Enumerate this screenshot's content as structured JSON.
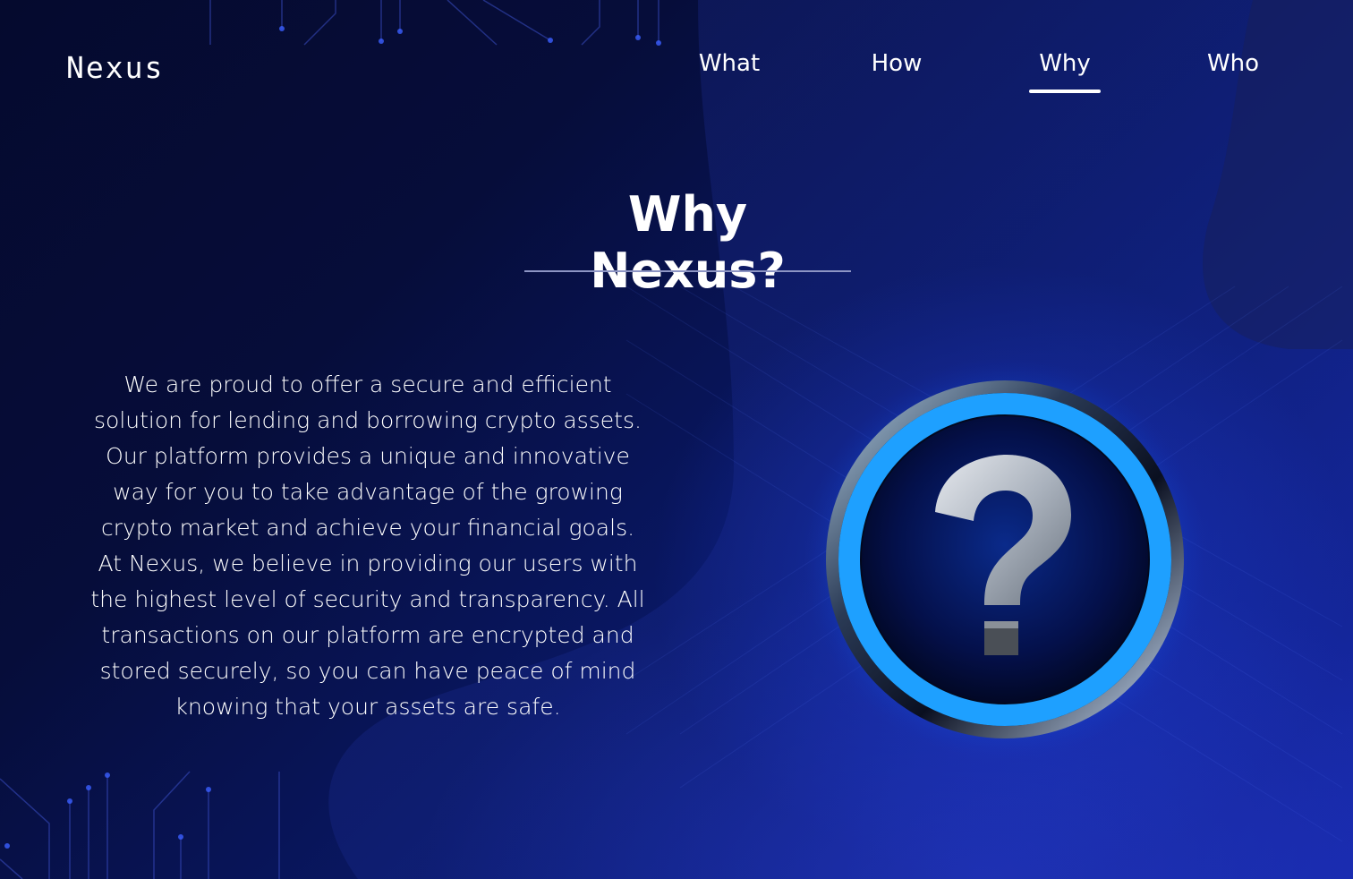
{
  "brand": {
    "name": "Nexus"
  },
  "nav": {
    "items": [
      {
        "label": "What"
      },
      {
        "label": "How"
      },
      {
        "label": "Why"
      },
      {
        "label": "Who"
      }
    ],
    "active_item": "Why"
  },
  "section": {
    "title": "Why Nexus?",
    "paragraphs": [
      "We are proud to offer a secure and efficient solution for lending and borrowing crypto assets. Our platform provides a unique and innovative way for you to take advantage of the growing crypto market and achieve your financial goals.",
      "At Nexus, we believe in providing our users with the highest level of security and transparency. All transactions on our platform are encrypted and stored securely, so you can have peace of mind knowing that your assets are safe."
    ]
  },
  "icons": {
    "question": "question-mark-icon",
    "circuit": "circuit-lines-decoration"
  },
  "colors": {
    "background_dark": "#050a2e",
    "background_blue": "#1426a8",
    "accent_glow": "#1e90ff",
    "text": "#ffffff"
  }
}
